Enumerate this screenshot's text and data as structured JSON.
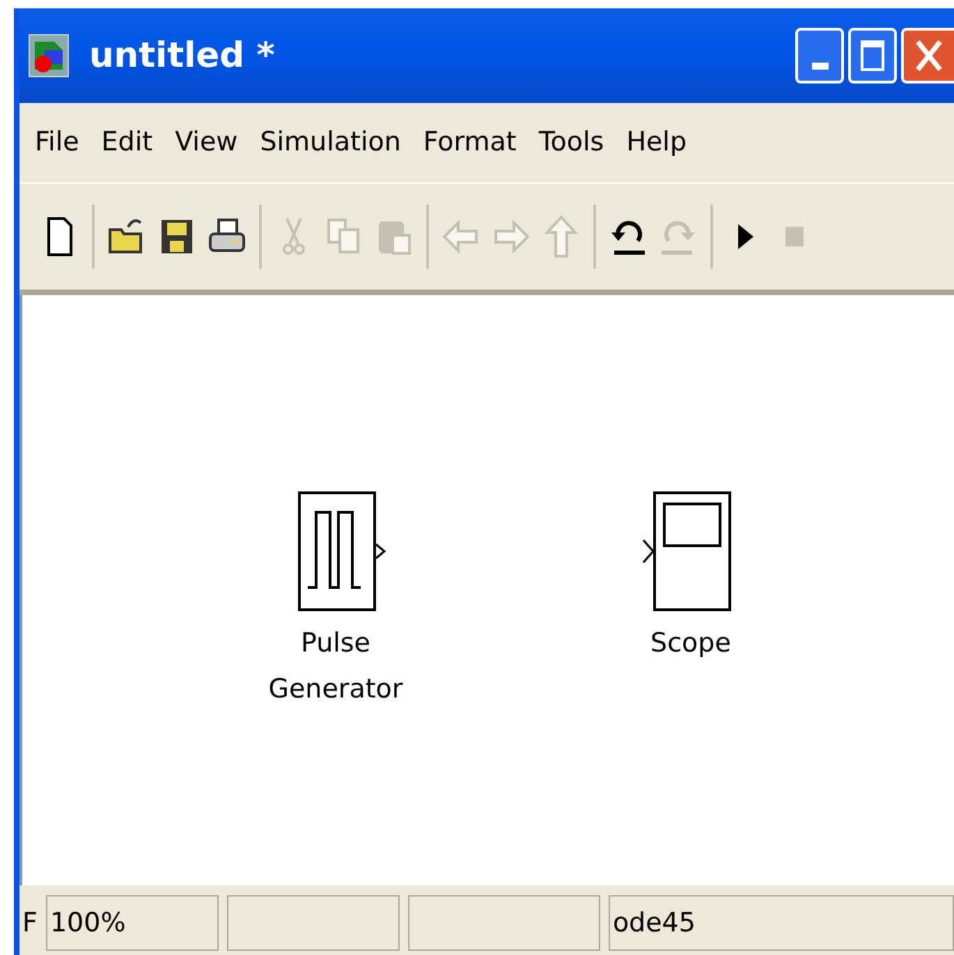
{
  "window": {
    "title": "untitled *"
  },
  "menu": [
    "File",
    "Edit",
    "View",
    "Simulation",
    "Format",
    "Tools",
    "Help"
  ],
  "toolbar": [
    {
      "kind": "new",
      "disabled": false
    },
    {
      "kind": "sep"
    },
    {
      "kind": "open",
      "disabled": false
    },
    {
      "kind": "save",
      "disabled": false
    },
    {
      "kind": "print",
      "disabled": false
    },
    {
      "kind": "sep"
    },
    {
      "kind": "cut",
      "disabled": true
    },
    {
      "kind": "copy",
      "disabled": true
    },
    {
      "kind": "paste",
      "disabled": true
    },
    {
      "kind": "sep"
    },
    {
      "kind": "back",
      "disabled": true
    },
    {
      "kind": "forward",
      "disabled": true
    },
    {
      "kind": "up",
      "disabled": true
    },
    {
      "kind": "sep"
    },
    {
      "kind": "undo",
      "disabled": false
    },
    {
      "kind": "redo",
      "disabled": true
    },
    {
      "kind": "sep"
    },
    {
      "kind": "start",
      "disabled": false
    },
    {
      "kind": "stop",
      "disabled": true
    }
  ],
  "blocks": [
    {
      "kind": "pulse",
      "label": [
        "Pulse",
        "Generator"
      ]
    },
    {
      "kind": "scope",
      "label": [
        "Scope"
      ]
    }
  ],
  "status_bar": {
    "label": "F",
    "zoom": "100%",
    "solver": "ode45"
  }
}
